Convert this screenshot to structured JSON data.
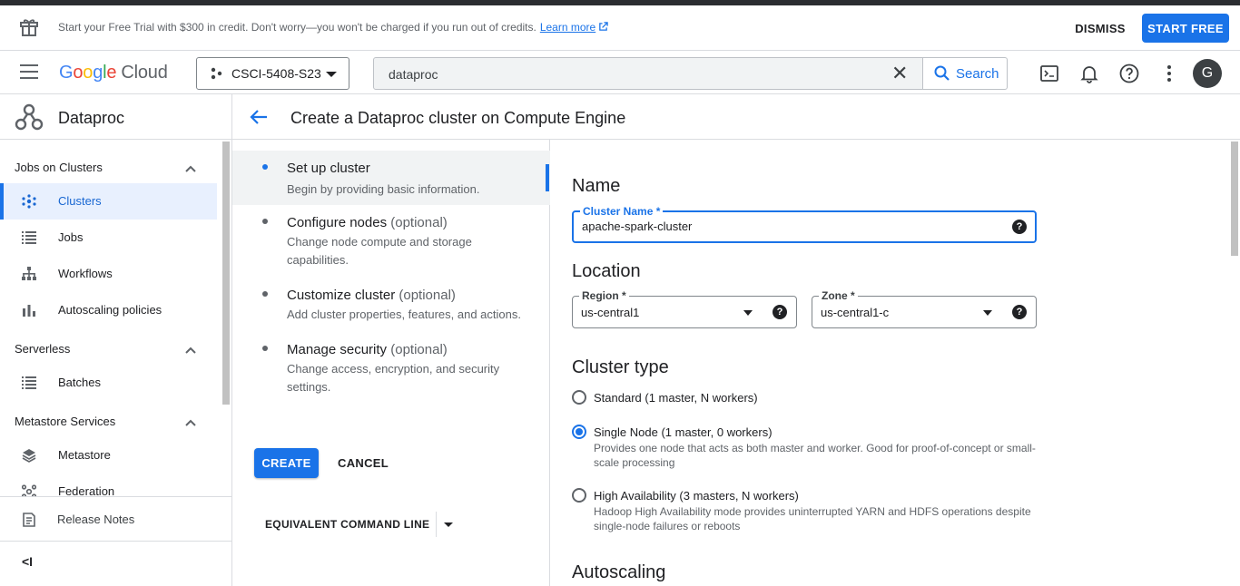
{
  "banner": {
    "message": "Start your Free Trial with $300 in credit. Don't worry—you won't be charged if you run out of credits.",
    "learn_more": "Learn more",
    "dismiss": "DISMISS",
    "start_free": "START FREE"
  },
  "header": {
    "logo": {
      "g": "G",
      "o1": "o",
      "o2": "o",
      "g2": "g",
      "l": "l",
      "e": "e",
      "cloud": "Cloud"
    },
    "project": "CSCI-5408-S23",
    "search_value": "dataproc",
    "search_button": "Search",
    "avatar_letter": "G"
  },
  "nav": {
    "product": "Dataproc",
    "sections": [
      {
        "title": "Jobs on Clusters",
        "items": [
          "Clusters",
          "Jobs",
          "Workflows",
          "Autoscaling policies"
        ]
      },
      {
        "title": "Serverless",
        "items": [
          "Batches"
        ]
      },
      {
        "title": "Metastore Services",
        "items": [
          "Metastore",
          "Federation"
        ]
      }
    ],
    "release_notes": "Release Notes",
    "collapse": "<I"
  },
  "page": {
    "title": "Create a Dataproc cluster on Compute Engine"
  },
  "steps": [
    {
      "title": "Set up cluster",
      "optional": "",
      "desc": "Begin by providing basic information."
    },
    {
      "title": "Configure nodes",
      "optional": "(optional)",
      "desc": "Change node compute and storage capabilities."
    },
    {
      "title": "Customize cluster",
      "optional": "(optional)",
      "desc": "Add cluster properties, features, and actions."
    },
    {
      "title": "Manage security",
      "optional": "(optional)",
      "desc": "Change access, encryption, and security settings."
    }
  ],
  "actions": {
    "create": "CREATE",
    "cancel": "CANCEL",
    "equivalent": "EQUIVALENT COMMAND LINE"
  },
  "form": {
    "name_heading": "Name",
    "cluster_name_label": "Cluster Name *",
    "cluster_name_value": "apache-spark-cluster",
    "location_heading": "Location",
    "region_label": "Region *",
    "region_value": "us-central1",
    "zone_label": "Zone *",
    "zone_value": "us-central1-c",
    "cluster_type_heading": "Cluster type",
    "cluster_types": [
      {
        "label": "Standard (1 master, N workers)",
        "desc": "",
        "selected": false
      },
      {
        "label": "Single Node (1 master, 0 workers)",
        "desc": "Provides one node that acts as both master and worker. Good for proof-of-concept or small-scale processing",
        "selected": true
      },
      {
        "label": "High Availability (3 masters, N workers)",
        "desc": "Hadoop High Availability mode provides uninterrupted YARN and HDFS operations despite single-node failures or reboots",
        "selected": false
      }
    ],
    "autoscaling_heading": "Autoscaling",
    "help_glyph": "?"
  },
  "colors": {
    "accent": "#1a73e8",
    "active_bg": "#e8f0fe"
  }
}
